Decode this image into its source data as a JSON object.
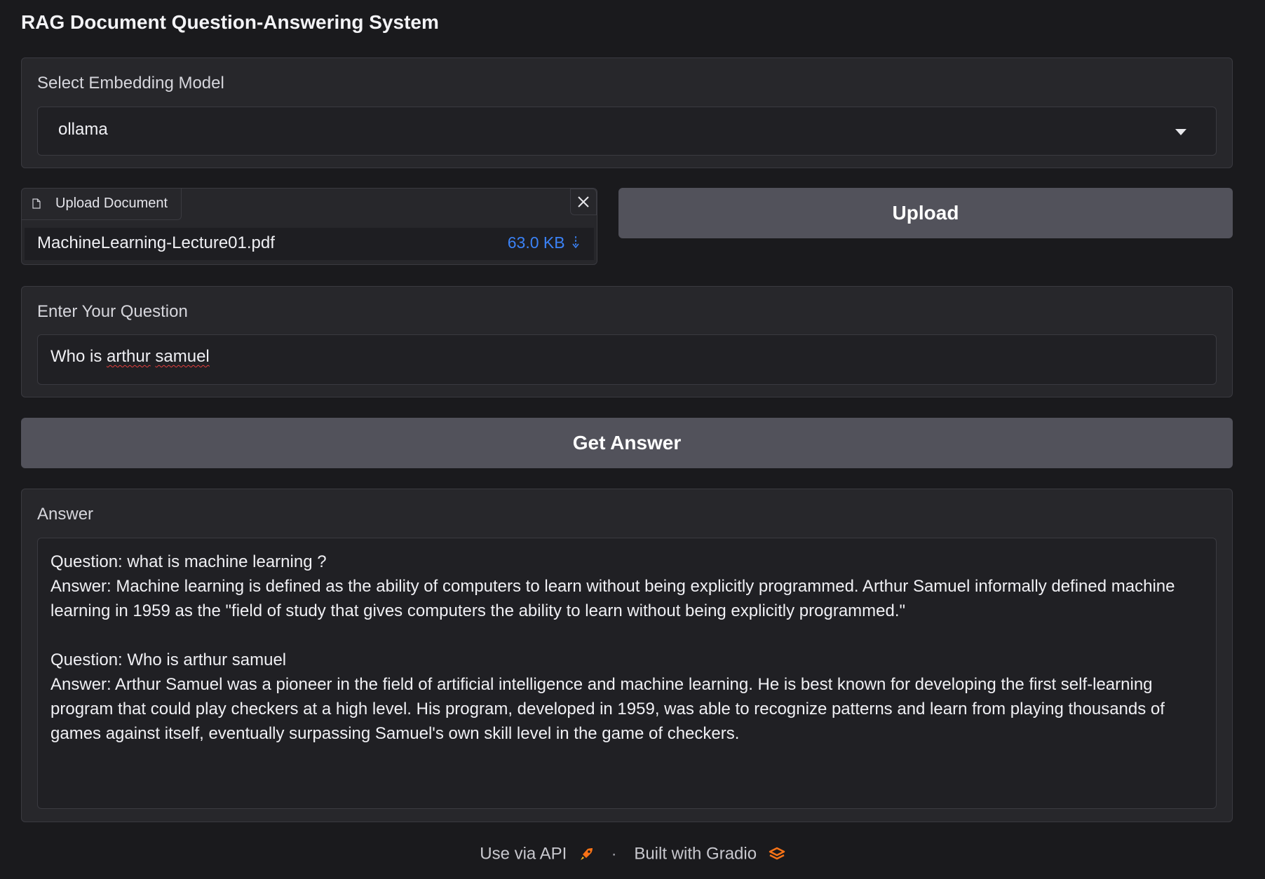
{
  "app": {
    "title": "RAG Document Question-Answering System"
  },
  "embedding": {
    "label": "Select Embedding Model",
    "selected": "ollama"
  },
  "upload": {
    "tab_label": "Upload Document",
    "file_name": "MachineLearning-Lecture01.pdf",
    "file_size": "63.0 KB",
    "button_label": "Upload"
  },
  "question": {
    "label": "Enter Your Question",
    "value_prefix": "Who is ",
    "value_word1": "arthur",
    "value_space": " ",
    "value_word2": "samuel"
  },
  "actions": {
    "get_answer_label": "Get Answer"
  },
  "answer": {
    "label": "Answer",
    "text": "Question: what is machine learning ?\nAnswer: Machine learning is defined as the ability of computers to learn without being explicitly programmed. Arthur Samuel informally defined machine learning in 1959 as the \"field of study that gives computers the ability to learn without being explicitly programmed.\"\n\nQuestion: Who is arthur samuel\nAnswer: Arthur Samuel was a pioneer in the field of artificial intelligence and machine learning. He is best known for developing the first self-learning program that could play checkers at a high level. His program, developed in 1959, was able to recognize patterns and learn from playing thousands of games against itself, eventually surpassing Samuel's own skill level in the game of checkers."
  },
  "footer": {
    "api_label": "Use via API",
    "separator": "·",
    "built_label": "Built with Gradio"
  },
  "icons": {
    "file": "file-icon",
    "close": "close-icon",
    "download": "download-icon",
    "dropdown": "chevron-down-icon",
    "api": "rocket-icon",
    "gradio": "gradio-logo-icon"
  },
  "colors": {
    "background": "#1a1a1d",
    "panel": "#27272b",
    "button": "#52525b",
    "link": "#3b82f6",
    "gradio_accent": "#f97316"
  }
}
